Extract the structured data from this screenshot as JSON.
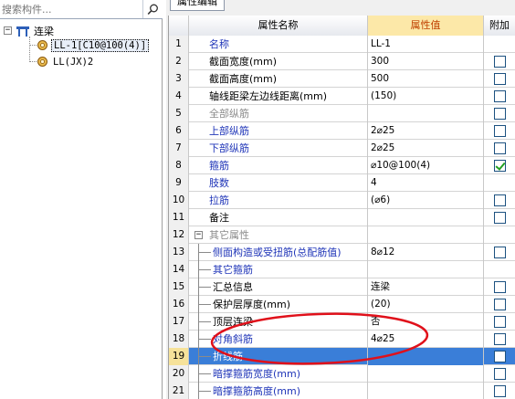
{
  "search": {
    "placeholder": "搜索构件..."
  },
  "tree": {
    "root_label": "连梁",
    "items": [
      {
        "label": "LL-1[C10@100(4)]",
        "selected": true
      },
      {
        "label": "LL(JX)2",
        "selected": false
      }
    ]
  },
  "panel": {
    "tab_label": "属性编辑"
  },
  "grid": {
    "headers": {
      "name": "属性名称",
      "value": "属性值",
      "extra": "附加"
    },
    "rows": [
      {
        "num": "1",
        "name": "名称",
        "value": "LL-1",
        "checkbox": false,
        "checked": false,
        "style": "blue"
      },
      {
        "num": "2",
        "name": "截面宽度(mm)",
        "value": "300",
        "checkbox": true,
        "checked": false,
        "style": "blk"
      },
      {
        "num": "3",
        "name": "截面高度(mm)",
        "value": "500",
        "checkbox": true,
        "checked": false,
        "style": "blk"
      },
      {
        "num": "4",
        "name": "轴线距梁左边线距离(mm)",
        "value": "(150)",
        "checkbox": true,
        "checked": false,
        "style": "blk"
      },
      {
        "num": "5",
        "name": "全部纵筋",
        "value": "",
        "checkbox": true,
        "checked": false,
        "style": "gray"
      },
      {
        "num": "6",
        "name": "上部纵筋",
        "value": "2⌀25",
        "checkbox": true,
        "checked": false,
        "style": "blue"
      },
      {
        "num": "7",
        "name": "下部纵筋",
        "value": "2⌀25",
        "checkbox": true,
        "checked": false,
        "style": "blue"
      },
      {
        "num": "8",
        "name": "箍筋",
        "value": "⌀10@100(4)",
        "checkbox": true,
        "checked": true,
        "style": "blue"
      },
      {
        "num": "9",
        "name": "肢数",
        "value": "4",
        "checkbox": false,
        "checked": false,
        "style": "blue"
      },
      {
        "num": "10",
        "name": "拉筋",
        "value": "(⌀6)",
        "checkbox": true,
        "checked": false,
        "style": "blue"
      },
      {
        "num": "11",
        "name": "备注",
        "value": "",
        "checkbox": true,
        "checked": false,
        "style": "blk"
      },
      {
        "num": "12",
        "name": "其它属性",
        "value": "",
        "checkbox": false,
        "checked": false,
        "style": "gray",
        "group": true
      },
      {
        "num": "13",
        "name": "侧面构造或受扭筋(总配筋值)",
        "value": "8⌀12",
        "checkbox": true,
        "checked": false,
        "style": "blue",
        "child": true
      },
      {
        "num": "14",
        "name": "其它箍筋",
        "value": "",
        "checkbox": false,
        "checked": false,
        "style": "blue",
        "child": true
      },
      {
        "num": "15",
        "name": "汇总信息",
        "value": "连梁",
        "checkbox": true,
        "checked": false,
        "style": "blk",
        "child": true
      },
      {
        "num": "16",
        "name": "保护层厚度(mm)",
        "value": "(20)",
        "checkbox": true,
        "checked": false,
        "style": "blk",
        "child": true
      },
      {
        "num": "17",
        "name": "顶层连梁",
        "value": "否",
        "checkbox": true,
        "checked": false,
        "style": "blk",
        "child": true
      },
      {
        "num": "18",
        "name": "对角斜筋",
        "value": "4⌀25",
        "checkbox": true,
        "checked": false,
        "style": "blue",
        "child": true
      },
      {
        "num": "19",
        "name": "折线筋",
        "value": "",
        "checkbox": true,
        "checked": false,
        "style": "blue",
        "child": true,
        "highlight": true
      },
      {
        "num": "20",
        "name": "暗撑箍筋宽度(mm)",
        "value": "",
        "checkbox": true,
        "checked": false,
        "style": "blue",
        "child": true
      },
      {
        "num": "21",
        "name": "暗撑箍筋高度(mm)",
        "value": "",
        "checkbox": true,
        "checked": false,
        "style": "blue",
        "child": true
      }
    ]
  },
  "colors": {
    "annotation_ellipse": "#e0101a",
    "selection": "#3a7ed8",
    "header_value_bg": "#fce8a8"
  }
}
